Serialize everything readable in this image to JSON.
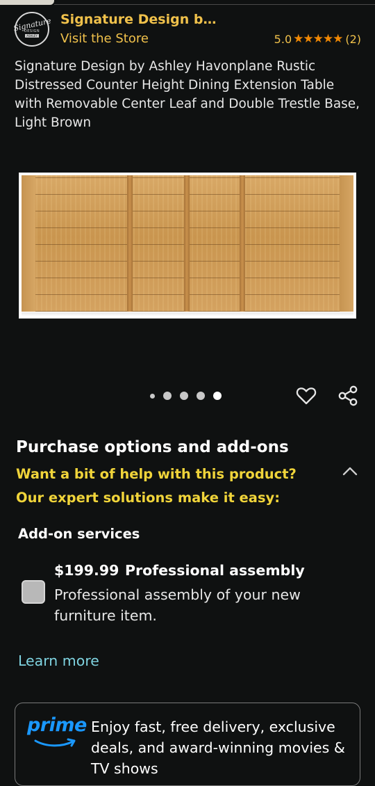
{
  "brand": {
    "name": "Signature Design b…",
    "visit_store": "Visit the Store",
    "logo_text_script": "Signature",
    "logo_text_design": "DESIGN",
    "logo_text_ashley": "ASHLEY"
  },
  "rating": {
    "value": "5.0",
    "stars": "★★★★★",
    "count": "(2)"
  },
  "product": {
    "title": "Signature Design by Ashley Havonplane Rustic Distressed Counter Height Dining Extension Table with Removable Center Leaf and Double Trestle Base, Light Brown"
  },
  "carousel": {
    "total_images": 5,
    "active_index": 4
  },
  "purchase_options": {
    "heading": "Purchase options and add-ons",
    "help_line1": "Want a bit of help with this product?",
    "help_line2": "Our expert solutions make it easy:"
  },
  "addon": {
    "heading": "Add-on services",
    "price": "$199.99",
    "name": "Professional assembly",
    "description": "Professional assembly of your new furniture item.",
    "checked": false,
    "learn_more": "Learn more"
  },
  "prime": {
    "logo_word": "prime",
    "text": "Enjoy fast, free delivery, exclusive deals, and award-winning movies & TV shows"
  },
  "colors": {
    "background": "#0f1111",
    "brand_link": "#f0c14b",
    "star": "#f08804",
    "help_text": "#f0d43a",
    "learn_more": "#7fd3e0",
    "prime_blue": "#1a98ff"
  },
  "icons": {
    "favorite": "heart-icon",
    "share": "share-icon",
    "collapse": "chevron-up-icon"
  }
}
